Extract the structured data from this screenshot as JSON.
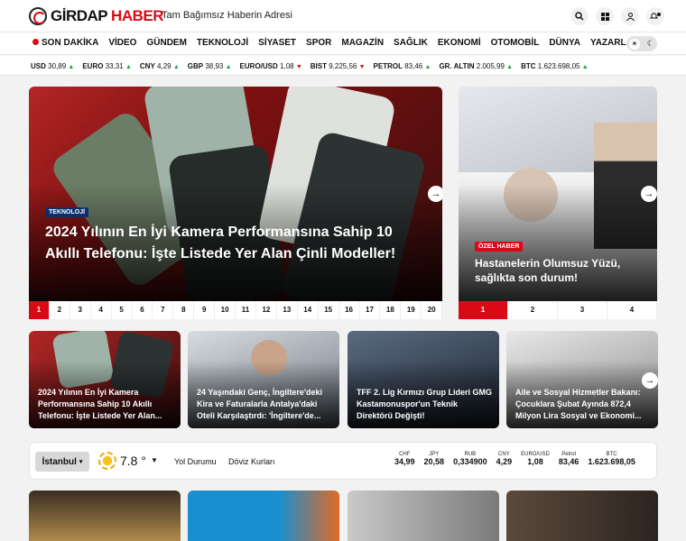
{
  "header": {
    "logo_part1": "GİRDAP",
    "logo_part2": "HABER",
    "slogan": "Tam Bağımsız Haberin Adresi",
    "icons": [
      "search-icon",
      "grid-icon",
      "user-icon",
      "bell-icon"
    ]
  },
  "nav": {
    "items": [
      "SON DAKİKA",
      "VİDEO",
      "GÜNDEM",
      "TEKNOLOJİ",
      "SİYASET",
      "SPOR",
      "MAGAZİN",
      "SAĞLIK",
      "EKONOMİ",
      "OTOMOBİL",
      "DÜNYA",
      "YAZARLAR"
    ],
    "theme_light": "☀",
    "theme_dark": "☾"
  },
  "ticker": [
    {
      "name": "USD",
      "value": "30,89",
      "trend": "up"
    },
    {
      "name": "EURO",
      "value": "33,31",
      "trend": "up"
    },
    {
      "name": "CNY",
      "value": "4,29",
      "trend": "up"
    },
    {
      "name": "GBP",
      "value": "38,93",
      "trend": "up"
    },
    {
      "name": "EURO/USD",
      "value": "1,08",
      "trend": "down"
    },
    {
      "name": "BIST",
      "value": "9.225,56",
      "trend": "down"
    },
    {
      "name": "PETROL",
      "value": "83,46",
      "trend": "up"
    },
    {
      "name": "GR. ALTIN",
      "value": "2.005,99",
      "trend": "up"
    },
    {
      "name": "BTC",
      "value": "1.623.698,05",
      "trend": "up"
    }
  ],
  "hero": {
    "badge": "TEKNOLOJİ",
    "title": "2024 Yılının En İyi Kamera Performansına Sahip 10 Akıllı Telefonu: İşte Listede Yer Alan Çinli Modeller!",
    "arrow": "→",
    "pages": [
      "1",
      "2",
      "3",
      "4",
      "5",
      "6",
      "7",
      "8",
      "9",
      "10",
      "11",
      "12",
      "13",
      "14",
      "15",
      "16",
      "17",
      "18",
      "19",
      "20"
    ]
  },
  "side": {
    "badge": "ÖZEL HABER",
    "title": "Hastanelerin Olumsuz Yüzü, sağlıkta son durum!",
    "arrow": "→",
    "pages": [
      "1",
      "2",
      "3",
      "4"
    ]
  },
  "cards": [
    {
      "title": "2024 Yılının En İyi Kamera Performansına Sahip 10 Akıllı Telefonu: İşte Listede Yer Alan..."
    },
    {
      "title": "24 Yaşındaki Genç, İngiltere'deki Kira ve Faturalarla Antalya'daki Oteli Karşılaştırdı: 'İngiltere'de..."
    },
    {
      "title": "TFF 2. Lig Kırmızı Grup Lideri GMG Kastamonuspor'un Teknik Direktörü Değişti!"
    },
    {
      "title": "Aile ve Sosyal Hizmetler Bakanı: Çocuklara Şubat Ayında 872,4 Milyon Lira Sosyal ve Ekonomi..."
    }
  ],
  "cards_arrow": "→",
  "weather": {
    "city": "İstanbul",
    "temp": "7.8 °",
    "road": "Yol Durumu",
    "fx": "Döviz Kurları",
    "rates": [
      {
        "k": "CHF",
        "v": "34,99"
      },
      {
        "k": "JPY",
        "v": "20,58"
      },
      {
        "k": "RUB",
        "v": "0,334900"
      },
      {
        "k": "CNY",
        "v": "4,29"
      },
      {
        "k": "EURO/USD",
        "v": "1,08"
      },
      {
        "k": "Petrol",
        "v": "83,46"
      },
      {
        "k": "BTC",
        "v": "1.623.698,05"
      }
    ]
  },
  "colors": {
    "brand": "#d90a16",
    "up": "#1aa34a",
    "down": "#d90a16"
  }
}
